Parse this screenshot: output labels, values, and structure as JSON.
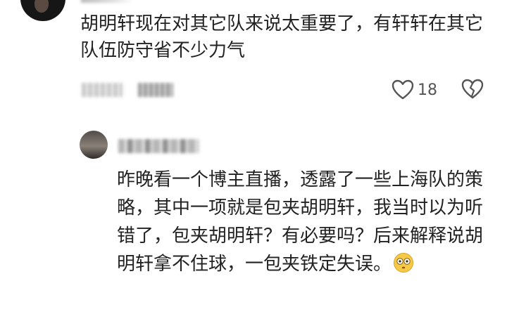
{
  "comment": {
    "text": "胡明轩现在对其它队来说太重要了，有轩轩在其它队伍防守省不少力气",
    "likes": {
      "count": "18",
      "icon": "heart-outline-icon"
    },
    "dislike": {
      "icon": "broken-heart-outline-icon"
    }
  },
  "reply": {
    "text": "昨晚看一个博主直播，透露了一些上海队的策略，其中一项就是包夹胡明轩，我当时以为听错了，包夹胡明轩？有必要吗？后来解释说胡明轩拿不住球，一包夹铁定失误。",
    "emoji": "flushed-face-emoji"
  },
  "colors": {
    "text": "#222222",
    "secondary": "#555555",
    "emoji_face": "#f7c948"
  }
}
